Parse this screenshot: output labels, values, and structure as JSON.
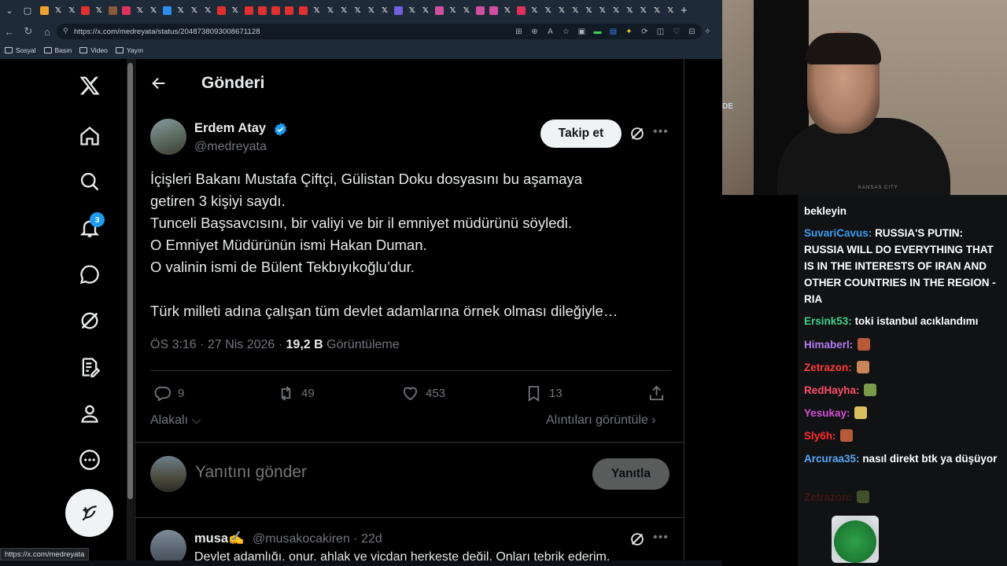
{
  "browser": {
    "url": "https://x.com/medreyata/status/2048738093008671128",
    "bookmarks": [
      "Sosyal",
      "Basın",
      "Video",
      "Yayın"
    ],
    "status_url": "https://x.com/medreyata"
  },
  "x": {
    "page_title": "Gönderi",
    "notification_count": "3",
    "tweet": {
      "author_name": "Erdem Atay",
      "author_handle": "@medreyata",
      "follow_label": "Takip et",
      "lines": [
        "İçişleri Bakanı Mustafa Çiftçi, Gülistan Doku dosyasını bu aşamaya",
        "getiren 3 kişiyi saydı.",
        "Tunceli Başsavcısını, bir valiyi ve bir il emniyet müdürünü söyledi.",
        "O Emniyet Müdürünün ismi Hakan Duman.",
        "O valinin ismi de Bülent Tekbıyıkoğlu’dur.",
        "",
        "Türk milleti adına çalışan tüm devlet adamlarına örnek olması dileğiyle…"
      ],
      "time": "ÖS 3:16",
      "date": "27 Nis 2026",
      "views_value": "19,2 B",
      "views_label": "Görüntüleme",
      "replies": "9",
      "reposts": "49",
      "likes": "453",
      "bookmarks": "13"
    },
    "related_label": "Alakalı",
    "quotes_label": "Alıntıları görüntüle",
    "reply_placeholder": "Yanıtını gönder",
    "reply_button": "Yanıtla",
    "first_reply": {
      "name": "musa",
      "emoji": "✍️",
      "handle": "@musakocakiren",
      "age": "22d",
      "text": "Devlet adamlığı, onur, ahlak ve vicdan herkeste değil. Onları tebrik ederim."
    }
  },
  "stream": {
    "webcam_shirt": "KANSAS CITY",
    "webcam_label": "DE",
    "chat": [
      {
        "user": "",
        "color": "#ffffff",
        "text": "bekleyin"
      },
      {
        "user": "SuvariCavus:",
        "color": "#3c9df2",
        "text": "RUSSIA'S PUTIN: RUSSIA WILL DO EVERYTHING THAT IS IN THE INTERESTS OF IRAN AND OTHER COUNTRIES IN THE REGION - RIA"
      },
      {
        "user": "Ersink53:",
        "color": "#3fd28a",
        "text": "toki istanbul acıklandımı"
      },
      {
        "user": "Himaberl:",
        "color": "#b57cf0",
        "text": ""
      },
      {
        "user": "Zetrazon:",
        "color": "#ff3b3b",
        "text": ""
      },
      {
        "user": "RedHayha:",
        "color": "#ff4d6d",
        "text": ""
      },
      {
        "user": "Yesukay:",
        "color": "#d14fd6",
        "text": ""
      },
      {
        "user": "Sly6h:",
        "color": "#ff2a2a",
        "text": ""
      },
      {
        "user": "Arcuraa35:",
        "color": "#5aa9f5",
        "text": "nasıl direkt btk ya düşüyor"
      },
      {
        "user": "Zetrazon:",
        "color": "#7a1f1f",
        "text": ""
      }
    ]
  }
}
